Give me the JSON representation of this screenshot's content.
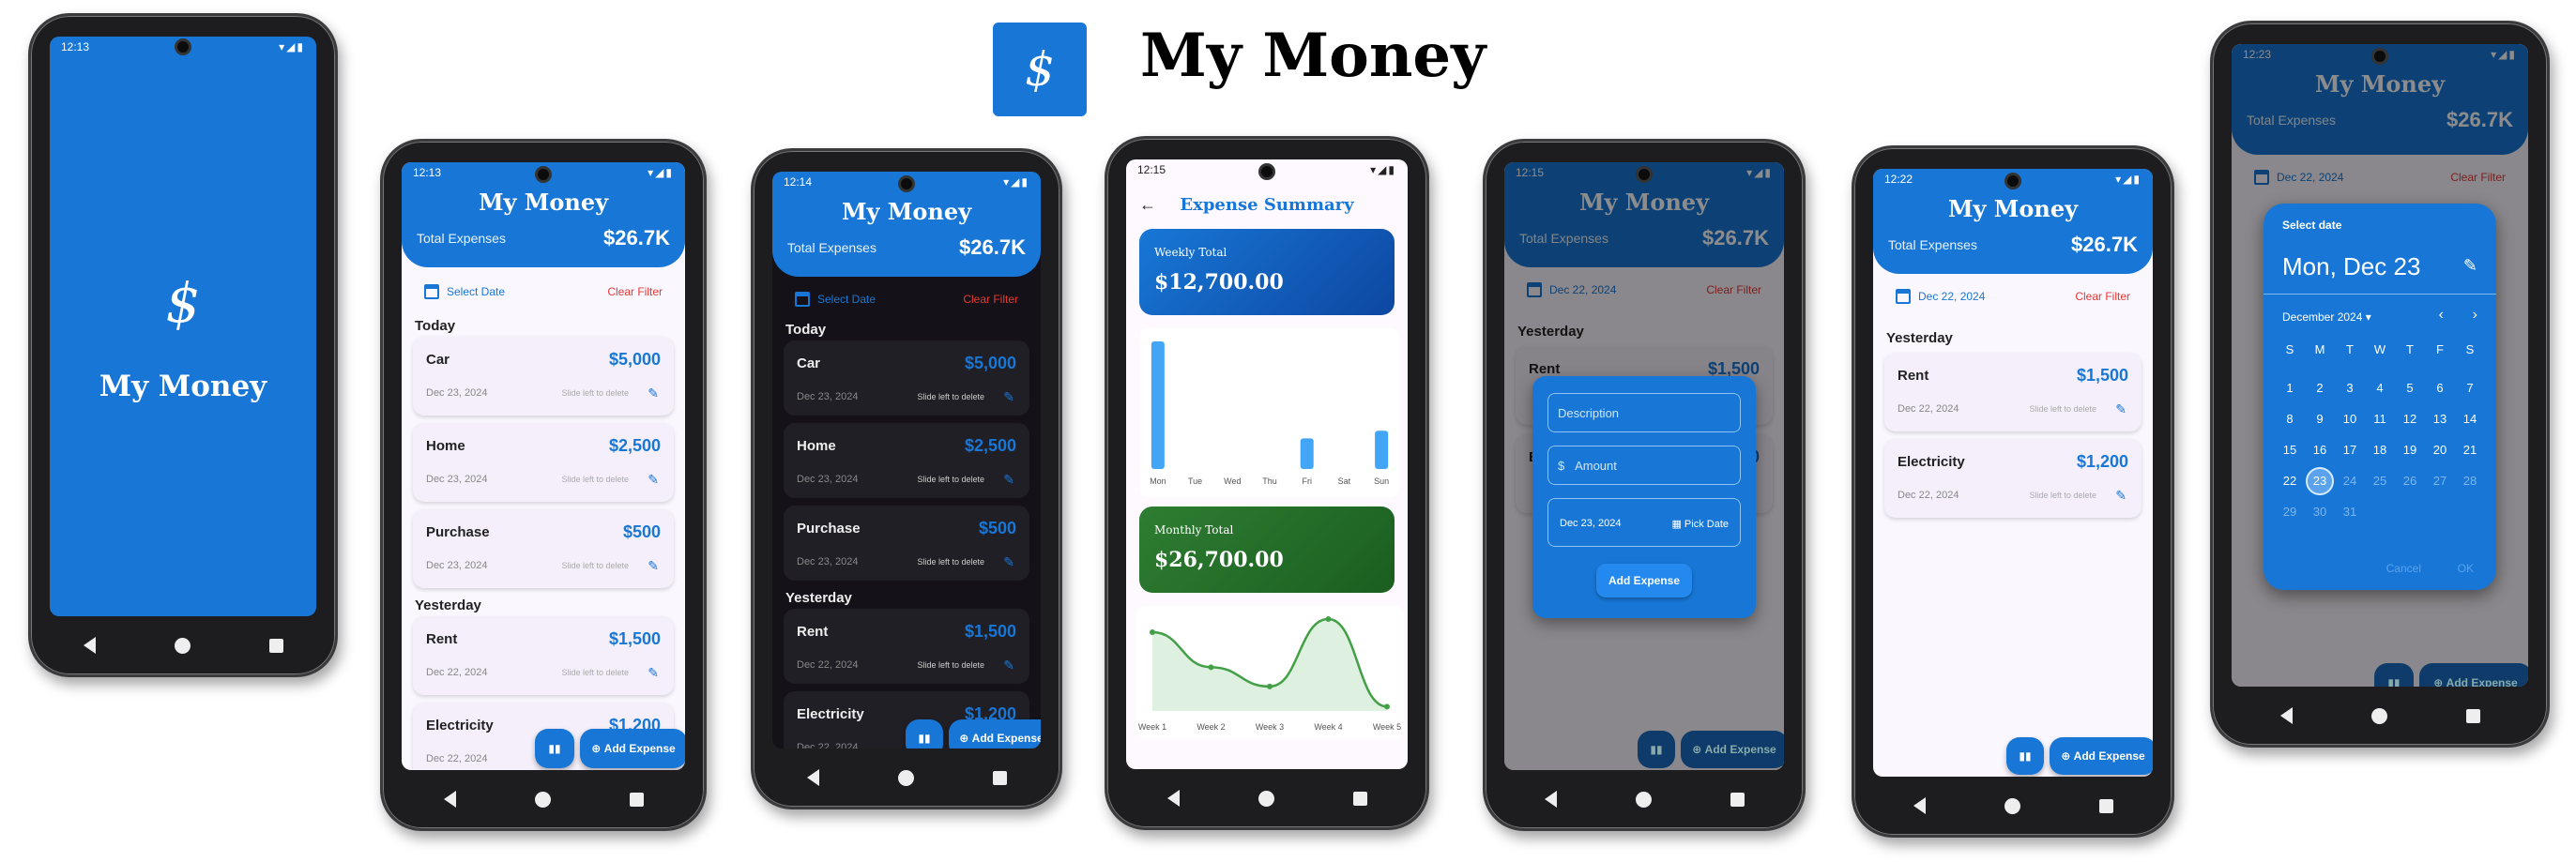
{
  "brand": {
    "title": "My Money",
    "logo_glyph": "$",
    "color": "#1877d6"
  },
  "status": {
    "t1": "12:13",
    "t2": "12:13",
    "t3": "12:14",
    "t4": "12:15",
    "t5": "12:15",
    "t6": "12:22",
    "t7": "12:23"
  },
  "app": {
    "title": "My Money",
    "total_label": "Total Expenses",
    "total_value": "$26.7K",
    "select_date": "Select Date",
    "clear_filter": "Clear Filter",
    "today": "Today",
    "yesterday": "Yesterday",
    "slide_hint": "Slide left to delete",
    "add_expense": "Add Expense",
    "filter_date": "Dec 22, 2024"
  },
  "expenses_today": [
    {
      "name": "Car",
      "amount": "$5,000",
      "date": "Dec 23, 2024"
    },
    {
      "name": "Home",
      "amount": "$2,500",
      "date": "Dec 23, 2024"
    },
    {
      "name": "Purchase",
      "amount": "$500",
      "date": "Dec 23, 2024"
    }
  ],
  "expenses_yesterday": [
    {
      "name": "Rent",
      "amount": "$1,500",
      "date": "Dec 22, 2024"
    },
    {
      "name": "Electricity",
      "amount": "$1,200",
      "date": "Dec 22, 2024"
    }
  ],
  "summary": {
    "title": "Expense Summary",
    "weekly_label": "Weekly Total",
    "weekly_value": "$12,700.00",
    "monthly_label": "Monthly Total",
    "monthly_value": "$26,700.00"
  },
  "chart_data": [
    {
      "type": "bar",
      "categories": [
        "Mon",
        "Tue",
        "Wed",
        "Thu",
        "Fri",
        "Sat",
        "Sun"
      ],
      "values": [
        5000,
        0,
        0,
        0,
        1200,
        0,
        1500
      ]
    },
    {
      "type": "line",
      "categories": [
        "Week 1",
        "Week 2",
        "Week 3",
        "Week 4",
        "Week 5"
      ],
      "values": [
        9000,
        5000,
        2800,
        10500,
        500
      ]
    }
  ],
  "dialog": {
    "description": "Description",
    "amount_ph": "Amount",
    "currency": "$",
    "date": "Dec 23, 2024",
    "pick_date": "Pick Date",
    "add": "Add Expense"
  },
  "picker": {
    "header": "Select date",
    "selected": "Mon, Dec 23",
    "month": "December 2024",
    "weekdays": [
      "S",
      "M",
      "T",
      "W",
      "T",
      "F",
      "S"
    ],
    "days": [
      "1",
      "2",
      "3",
      "4",
      "5",
      "6",
      "7",
      "8",
      "9",
      "10",
      "11",
      "12",
      "13",
      "14",
      "15",
      "16",
      "17",
      "18",
      "19",
      "20",
      "21",
      "22",
      "23",
      "24",
      "25",
      "26",
      "27",
      "28",
      "29",
      "30",
      "31"
    ],
    "cancel": "Cancel",
    "ok": "OK"
  }
}
